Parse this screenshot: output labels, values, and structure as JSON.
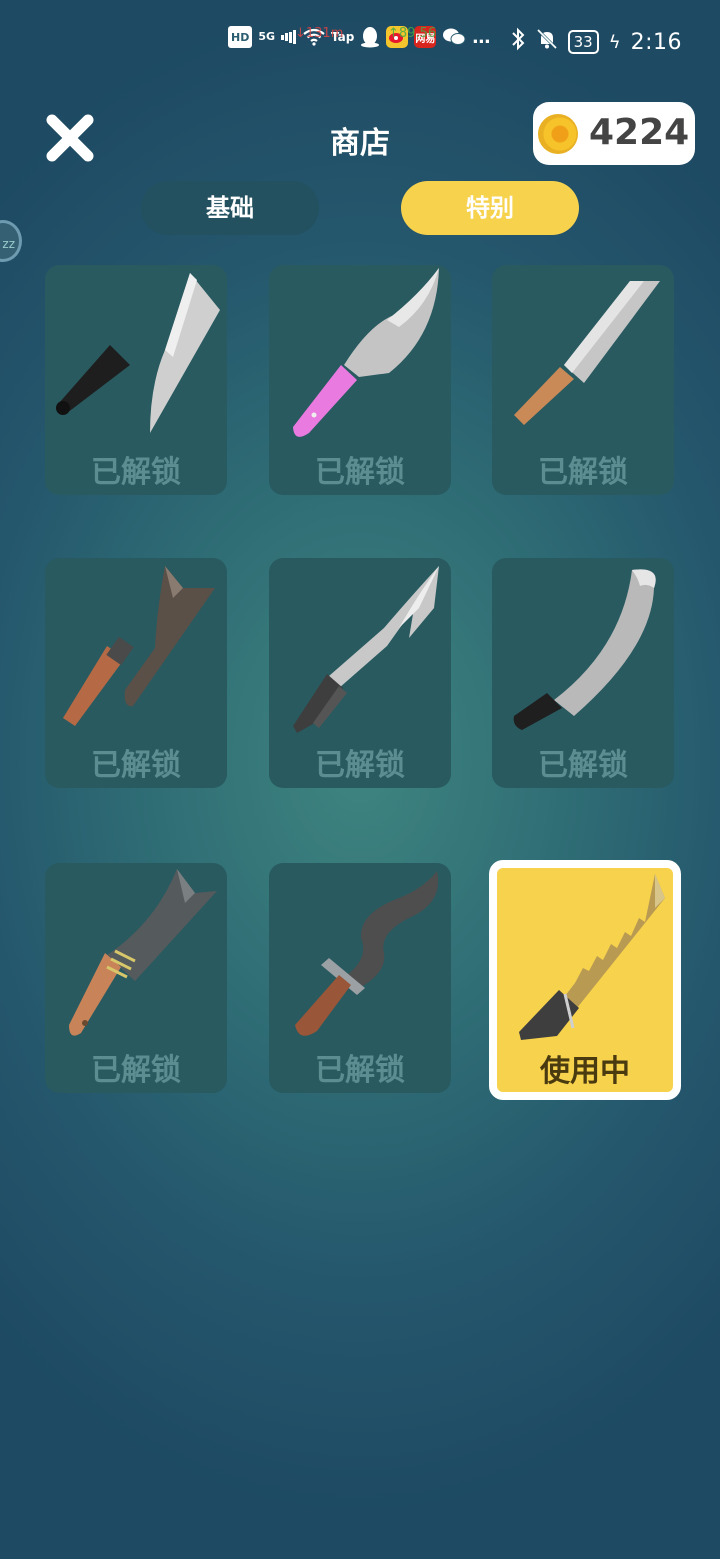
{
  "status_bar": {
    "left_icons": [
      "HD",
      "5G",
      "signal-bars",
      "wifi",
      "Tap",
      "qq",
      "weibo",
      "网易",
      "wechat",
      "…"
    ],
    "overlay_left": "↓131m",
    "overlay_right": "↑89.56",
    "battery": "33",
    "time": "2:16"
  },
  "header": {
    "title": "商店",
    "coins": "4224"
  },
  "tabs": [
    {
      "label": "基础",
      "active": false
    },
    {
      "label": "特别",
      "active": true
    }
  ],
  "side_handle": "zz",
  "items": [
    {
      "label": "已解锁",
      "blade": "cleaver",
      "handle_color": "#222222"
    },
    {
      "label": "已解锁",
      "blade": "pink-hook",
      "handle_color": "#e070d8"
    },
    {
      "label": "已解锁",
      "blade": "chef",
      "handle_color": "#c98a57"
    },
    {
      "label": "已解锁",
      "blade": "brown-axe",
      "handle_color": "#b56a45"
    },
    {
      "label": "已解锁",
      "blade": "barbed",
      "handle_color": "#555555"
    },
    {
      "label": "已解锁",
      "blade": "curved",
      "handle_color": "#222222"
    },
    {
      "label": "已解锁",
      "blade": "machete",
      "handle_color": "#c88458"
    },
    {
      "label": "已解锁",
      "blade": "wavy",
      "handle_color": "#9a5638"
    },
    {
      "label": "使用中",
      "blade": "golden-saw",
      "handle_color": "#555555",
      "active": true
    }
  ],
  "colors": {
    "accent": "#f7d24d",
    "card": "#285a60",
    "locked_text": "#5c8d90"
  }
}
